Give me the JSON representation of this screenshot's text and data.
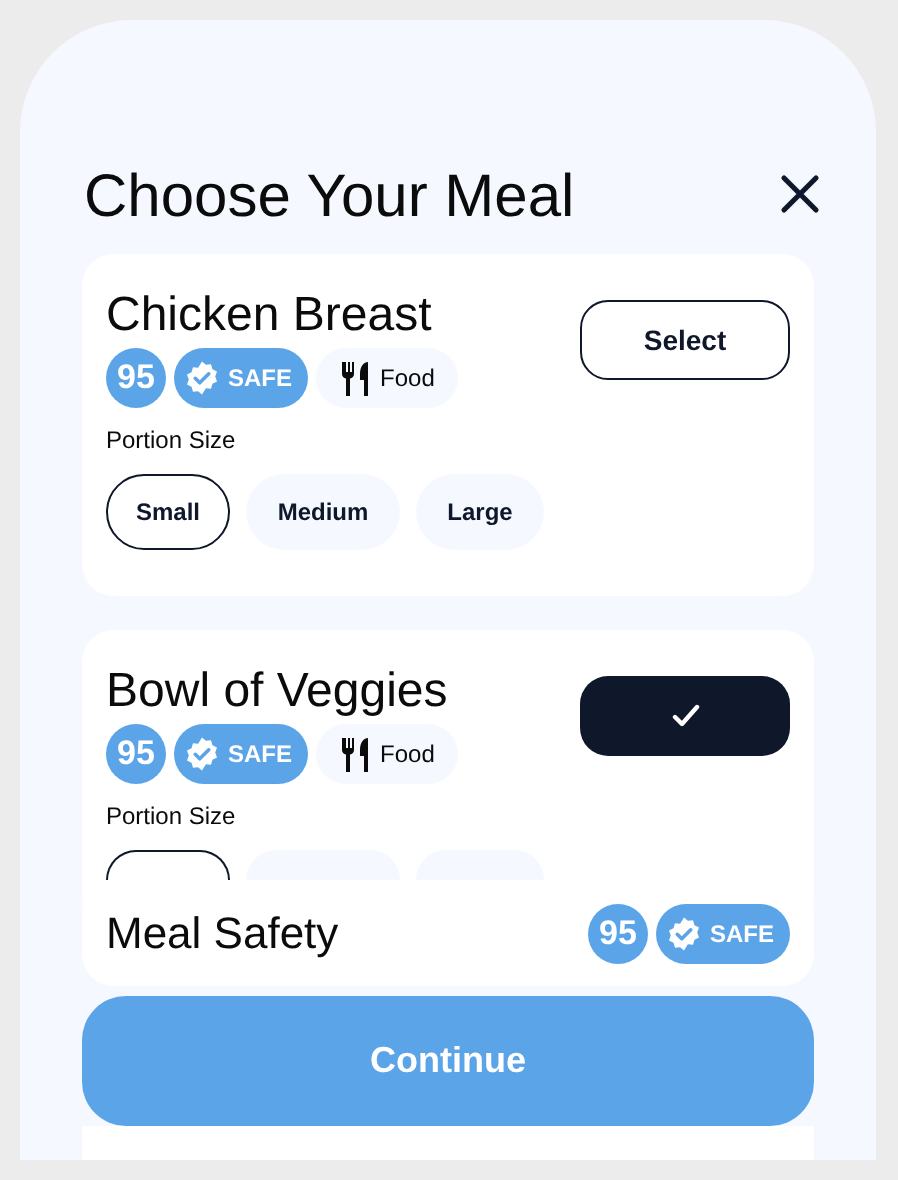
{
  "title": "Choose Your Meal",
  "meals": [
    {
      "name": "Chicken Breast",
      "score": "95",
      "safety": "SAFE",
      "category": "Food",
      "action": {
        "label": "Select",
        "selected": false
      },
      "portion_label": "Portion Size",
      "portions": [
        {
          "label": "Small",
          "selected": true
        },
        {
          "label": "Medium",
          "selected": false
        },
        {
          "label": "Large",
          "selected": false
        }
      ]
    },
    {
      "name": "Bowl of Veggies",
      "score": "95",
      "safety": "SAFE",
      "category": "Food",
      "action": {
        "selected": true
      },
      "portion_label": "Portion Size",
      "portions": [
        {
          "selected": true
        },
        {
          "selected": false
        },
        {
          "selected": false
        }
      ]
    }
  ],
  "safety_summary": {
    "title": "Meal Safety",
    "score": "95",
    "safety": "SAFE"
  },
  "continue_label": "Continue"
}
